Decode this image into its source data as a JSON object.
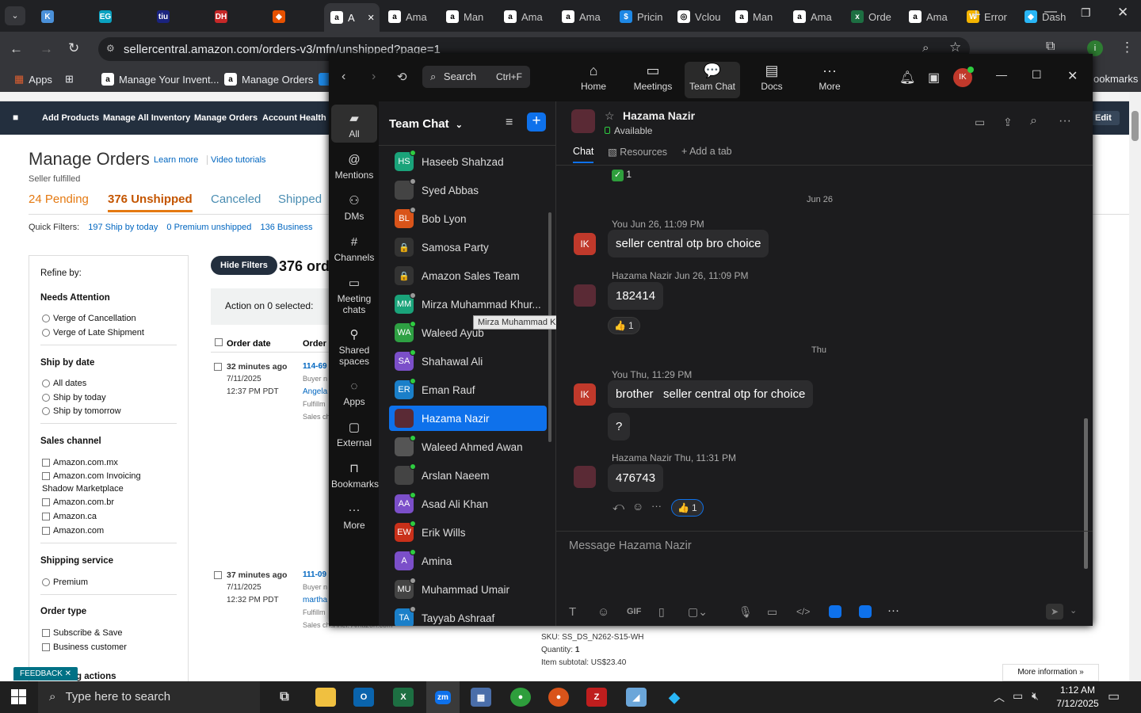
{
  "browser": {
    "tabs": [
      {
        "label": "",
        "icon": "K",
        "color": "#4a90d9"
      },
      {
        "label": "",
        "icon": "EG",
        "color": "#0aa2c0"
      },
      {
        "label": "",
        "icon": "tiu",
        "color": "#1a237e"
      },
      {
        "label": "",
        "icon": "DH",
        "color": "#c62828"
      },
      {
        "label": "",
        "icon": "◆",
        "color": "#e65100"
      },
      {
        "label": "A",
        "icon": "a",
        "color": "#ffffff"
      },
      {
        "label": "Ama",
        "icon": "a",
        "color": "#ffffff"
      },
      {
        "label": "Man",
        "icon": "a",
        "color": "#ffffff"
      },
      {
        "label": "Ama",
        "icon": "a",
        "color": "#ffffff"
      },
      {
        "label": "Ama",
        "icon": "a",
        "color": "#ffffff"
      },
      {
        "label": "Pricin",
        "icon": "$",
        "color": "#1e88e5"
      },
      {
        "label": "Vclou",
        "icon": "◎",
        "color": "#ffffff"
      },
      {
        "label": "Man",
        "icon": "a",
        "color": "#ffffff"
      },
      {
        "label": "Ama",
        "icon": "a",
        "color": "#ffffff"
      },
      {
        "label": "Orde",
        "icon": "x",
        "color": "#1d6f42"
      },
      {
        "label": "Ama",
        "icon": "a",
        "color": "#ffffff"
      },
      {
        "label": "Error",
        "icon": "W",
        "color": "#f4b400"
      },
      {
        "label": "Dash",
        "icon": "◆",
        "color": "#29b6f6"
      }
    ],
    "url": "sellercentral.amazon.com/orders-v3/mfn/unshipped?page=1",
    "bookmarks": [
      "Apps",
      "Manage Your Invent...",
      "Manage Orders"
    ],
    "bookmarks_right": "ookmarks"
  },
  "seller": {
    "nav": [
      "Add Products",
      "Manage All Inventory",
      "Manage Orders",
      "Account Health"
    ],
    "edit": "Edit",
    "title": "Manage Orders",
    "learn_more": "Learn more",
    "video_tutorials": "Video tutorials",
    "seller_fulfilled": "Seller fulfilled",
    "tabs": {
      "pending": "24 Pending",
      "unshipped": "376 Unshipped",
      "canceled": "Canceled",
      "shipped": "Shipped"
    },
    "quick_filters_label": "Quick Filters:",
    "quick_filters": [
      "197 Ship by today",
      "0 Premium unshipped",
      "136 Business"
    ],
    "hide_filters": "Hide Filters",
    "orders_count": "376 ord",
    "action_label": "Action on 0 selected:",
    "columns": [
      "Order date",
      "Order d"
    ],
    "refine_by": "Refine by:",
    "needs_attention": "Needs Attention",
    "needs_attention_opts": [
      "Verge of Cancellation",
      "Verge of Late Shipment"
    ],
    "ship_by_date": "Ship by date",
    "ship_by_opts": [
      "All dates",
      "Ship by today",
      "Ship by tomorrow"
    ],
    "sales_channel": "Sales channel",
    "sales_channel_opts": [
      "Amazon.com.mx",
      "Amazon.com Invoicing",
      "Shadow Marketplace",
      "Amazon.com.br",
      "Amazon.ca",
      "Amazon.com"
    ],
    "shipping_service": "Shipping service",
    "shipping_opts": [
      "Premium"
    ],
    "order_type": "Order type",
    "order_type_opts": [
      "Subscribe & Save",
      "Business customer"
    ],
    "more_actions": "ng actions",
    "feedback": "FEEDBACK",
    "orders": [
      {
        "ago": "32 minutes ago",
        "date": "7/11/2025",
        "time": "12:37 PM PDT",
        "id": "114-69",
        "buyer": "Buyer n",
        "name": "Angela",
        "fulfil": "Fulfillm",
        "sales": "Sales ch"
      },
      {
        "ago": "37 minutes ago",
        "date": "7/11/2025",
        "time": "12:32 PM PDT",
        "id": "111-09",
        "buyer": "Buyer n",
        "name": "martha",
        "fulfil": "Fulfillm",
        "sales": "Sales channel: Amazon.com"
      }
    ],
    "sku": "SKU: SS_DS_N262-S15-WH",
    "quantity_label": "Quantity:",
    "quantity": "1",
    "subtotal": "Item subtotal: US$23.40",
    "more_info": "More information »"
  },
  "zoom": {
    "search": "Search",
    "search_shortcut": "Ctrl+F",
    "top_tabs": [
      "Home",
      "Meetings",
      "Team Chat",
      "Docs",
      "More"
    ],
    "user_initials": "IK",
    "rail": [
      "All",
      "Mentions",
      "DMs",
      "Channels",
      "Meeting chats",
      "Shared spaces",
      "Apps",
      "External",
      "Bookmarks",
      "More"
    ],
    "list_title": "Team Chat",
    "contacts": [
      {
        "name": "Haseeb Shahzad",
        "initials": "HS",
        "color": "#1aa37a",
        "status": "#2ecc40"
      },
      {
        "name": "Syed Abbas",
        "initials": "",
        "color": "#444",
        "status": "#999"
      },
      {
        "name": "Bob Lyon",
        "initials": "BL",
        "color": "#d9541a",
        "status": "#999"
      },
      {
        "name": "Samosa Party",
        "initials": "🔒",
        "color": "#333",
        "status": ""
      },
      {
        "name": "Amazon Sales Team",
        "initials": "🔒",
        "color": "#333",
        "status": ""
      },
      {
        "name": "Mirza Muhammad Khur...",
        "initials": "MM",
        "color": "#1aa37a",
        "status": "#999"
      },
      {
        "name": "Waleed Ayub",
        "initials": "WA",
        "color": "#2ea043",
        "status": "#2ecc40"
      },
      {
        "name": "Shahawal Ali",
        "initials": "SA",
        "color": "#7b4fc9",
        "status": "#2ecc40"
      },
      {
        "name": "Eman Rauf",
        "initials": "ER",
        "color": "#1a7fc9",
        "status": "#2ecc40"
      },
      {
        "name": "Hazama Nazir",
        "initials": "",
        "color": "#5a2a35",
        "status": ""
      },
      {
        "name": "Waleed Ahmed Awan",
        "initials": "",
        "color": "#555",
        "status": "#2ecc40"
      },
      {
        "name": "Arslan Naeem",
        "initials": "",
        "color": "#444",
        "status": "#2ecc40"
      },
      {
        "name": "Asad Ali Khan",
        "initials": "AA",
        "color": "#7b4fc9",
        "status": "#2ecc40"
      },
      {
        "name": "Erik Wills",
        "initials": "EW",
        "color": "#c9301a",
        "status": "#2ecc40"
      },
      {
        "name": "Amina",
        "initials": "A",
        "color": "#7b4fc9",
        "status": "#2ecc40"
      },
      {
        "name": "Muhammad Umair",
        "initials": "MU",
        "color": "#444",
        "status": "#999"
      },
      {
        "name": "Tayyab Ashraaf",
        "initials": "TA",
        "color": "#1a7fc9",
        "status": "#999"
      }
    ],
    "tooltip": "Mirza Muhammad Khurram",
    "chat": {
      "name": "Hazama Nazir",
      "status": "Available",
      "tabs": [
        "Chat",
        "Resources",
        "Add a tab"
      ],
      "top_reaction": "1",
      "date1": "Jun 26",
      "date2": "Thu",
      "messages": [
        {
          "sender": "You",
          "time": "Jun 26, 11:09 PM",
          "text": "seller central otp bro choice"
        },
        {
          "sender": "Hazama Nazir",
          "time": "Jun 26, 11:09 PM",
          "text": "182414",
          "reaction": "1"
        },
        {
          "sender": "You",
          "time": "Thu, 11:29 PM",
          "text": "brother   seller central otp for choice"
        },
        {
          "sender": "",
          "time": "",
          "text": "?"
        },
        {
          "sender": "Hazama Nazir",
          "time": "Thu, 11:31 PM",
          "text": "476743",
          "reaction": "1"
        }
      ],
      "placeholder": "Message Hazama Nazir",
      "toolbar_gif": "GIF"
    }
  },
  "taskbar": {
    "search": "Type here to search",
    "time": "1:12 AM",
    "date": "7/12/2025"
  }
}
